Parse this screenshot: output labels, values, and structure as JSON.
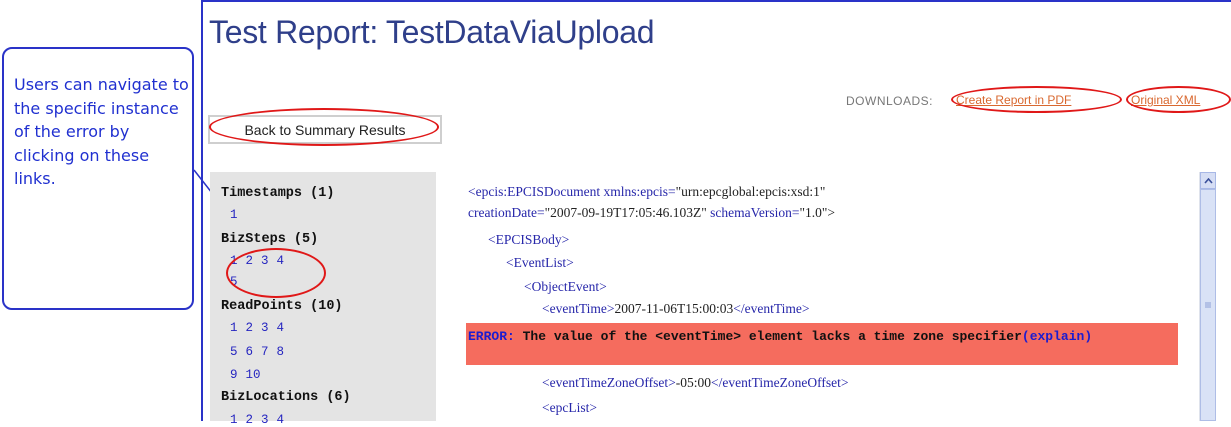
{
  "page": {
    "title": "Test Report: TestDataViaUpload"
  },
  "callout": {
    "text": "Users can navigate to the specific instance of the error by clicking on these links."
  },
  "downloads": {
    "label": "DOWNLOADS:",
    "pdf_link": "Create Report in PDF",
    "xml_link": "Original XML"
  },
  "back_button": {
    "label": "Back to Summary Results"
  },
  "nav": {
    "sections": [
      {
        "heading": "Timestamps (1)",
        "rows": [
          [
            "1"
          ]
        ]
      },
      {
        "heading": "BizSteps (5)",
        "rows": [
          [
            "1",
            "2",
            "3",
            "4"
          ],
          [
            "5"
          ]
        ]
      },
      {
        "heading": "ReadPoints (10)",
        "rows": [
          [
            "1",
            "2",
            "3",
            "4"
          ],
          [
            "5",
            "6",
            "7",
            "8"
          ],
          [
            "9",
            "10"
          ]
        ]
      },
      {
        "heading": "BizLocations (6)",
        "rows": [
          [
            "1",
            "2",
            "3",
            "4"
          ]
        ]
      }
    ]
  },
  "xml": {
    "line1_open": "<epcis:EPCISDocument",
    "line1_attr": "xmlns:epcis=",
    "line1_val": "\"urn:epcglobal:epcis:xsd:1\"",
    "line2_attr1": "creationDate=",
    "line2_val1": "\"2007-09-19T17:05:46.103Z\"",
    "line2_attr2": "schemaVersion=",
    "line2_val2": "\"1.0\">",
    "line3": "<EPCISBody>",
    "line4": "<EventList>",
    "line5": "<ObjectEvent>",
    "line6_open": "<eventTime>",
    "line6_val": "2007-11-06T15:00:03",
    "line6_close": "</eventTime>",
    "line7_open": "<eventTimeZoneOffset>",
    "line7_val": "-05:00",
    "line7_close": "</eventTimeZoneOffset>",
    "line8": "<epcList>"
  },
  "error": {
    "label": "ERROR:",
    "message": "The value of the <eventTime> element lacks a time zone specifier",
    "explain": "(explain)"
  },
  "colors": {
    "title": "#2f3f8a",
    "error_bg": "#f56c5e",
    "annotation": "#e01818",
    "callout": "#2030d0",
    "link": "#2525c0"
  }
}
